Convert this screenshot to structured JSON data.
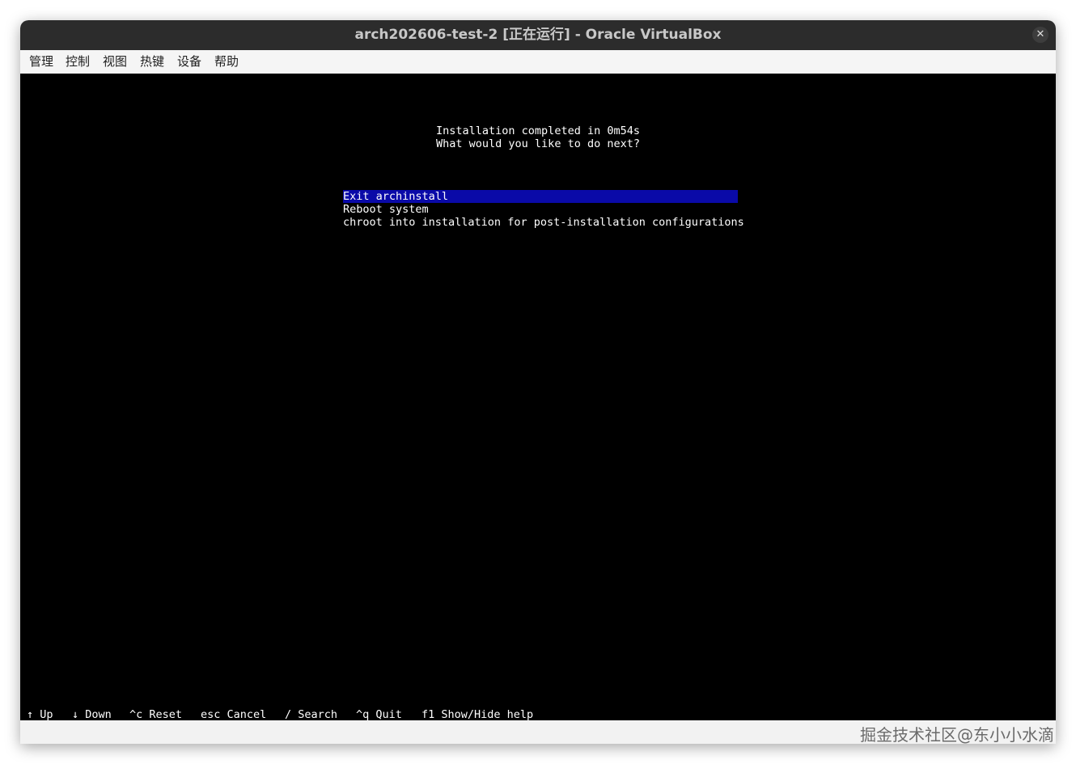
{
  "window": {
    "title": "arch202606-test-2 [正在运行] - Oracle VirtualBox",
    "close_glyph": "✕"
  },
  "menubar": {
    "items": [
      "管理",
      "控制",
      "视图",
      "热键",
      "设备",
      "帮助"
    ]
  },
  "terminal": {
    "message_lines": [
      "Installation completed in 0m54s",
      "What would you like to do next?"
    ],
    "options": [
      "Exit archinstall",
      "Reboot system",
      "chroot into installation for post-installation configurations"
    ],
    "selected_option": "Exit archinstall",
    "key_hints": [
      "↑ Up",
      "↓ Down",
      "^c Reset",
      "esc Cancel",
      "/ Search",
      "^q Quit",
      "f1 Show/Hide help"
    ]
  },
  "watermark": "掘金技术社区@东小小水滴",
  "colors": {
    "titlebar_bg": "#2c2c2c",
    "terminal_bg": "#000000",
    "selection_bg": "#0a0aa8",
    "terminal_fg": "#ffffff"
  }
}
